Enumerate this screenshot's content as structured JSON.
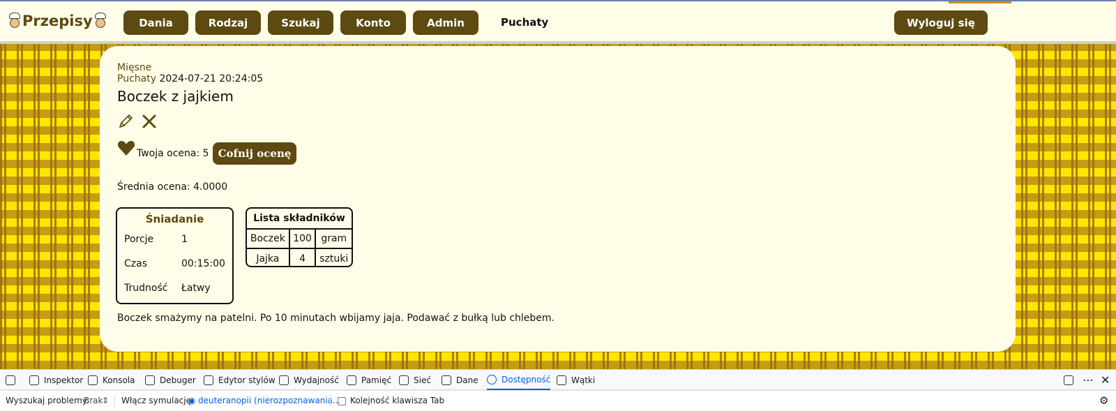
{
  "nav": {
    "logo": "Przepisy",
    "buttons": [
      "Dania",
      "Rodzaj",
      "Szukaj",
      "Konto",
      "Admin"
    ],
    "user": "Puchaty",
    "logout": "Wyloguj się"
  },
  "recipe": {
    "category": "Mięsne",
    "author": "Puchaty",
    "date": "2024-07-21 20:24:05",
    "title": "Boczek z jajkiem",
    "rating_label": "Twoja ocena: 5",
    "undo_label": "Cofnij ocenę",
    "avg_label": "Średnia ocena: 4.0000",
    "info": {
      "header": "Śniadanie",
      "rows": [
        {
          "label": "Porcje",
          "value": "1"
        },
        {
          "label": "Czas",
          "value": "00:15:00"
        },
        {
          "label": "Trudność",
          "value": "Łatwy"
        }
      ]
    },
    "ingredients": {
      "header": "Lista składników",
      "rows": [
        [
          "Boczek",
          "100",
          "gram"
        ],
        [
          "Jajka",
          "4",
          "sztuki"
        ]
      ]
    },
    "description": "Boczek smażymy na patelni. Po 10 minutach wbijamy jaja. Podawać z bułką lub chlebem."
  },
  "devtools": {
    "tabs": [
      "Inspektor",
      "Konsola",
      "Debuger",
      "Edytor stylów",
      "Wydajność",
      "Pamięć",
      "Sieć",
      "Dane",
      "Dostępność",
      "Wątki"
    ],
    "active_tab": "Dostępność",
    "search_label": "Wyszukaj problemy:",
    "search_value": "Brak",
    "simulation_label": "Włącz symulację:",
    "simulation_value": "deuteranopii (nierozpoznawania...",
    "tab_order_label": "Kolejność klawisza Tab"
  },
  "colors": {
    "accent": "#5c4a10",
    "background_pattern": "#ffe600",
    "card": "#fffde8",
    "devtools_active": "#0061e0"
  }
}
